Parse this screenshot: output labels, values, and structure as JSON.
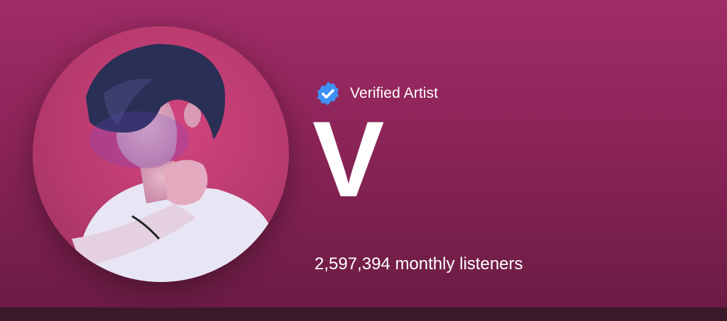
{
  "artist": {
    "verified_label": "Verified Artist",
    "name": "V",
    "monthly_listeners": "2,597,394 monthly listeners"
  },
  "icons": {
    "verified": "verified-badge-icon"
  },
  "colors": {
    "header_top": "#a02c66",
    "header_bottom": "#6b1c44",
    "badge": "#3d91f4",
    "text": "#ffffff"
  }
}
